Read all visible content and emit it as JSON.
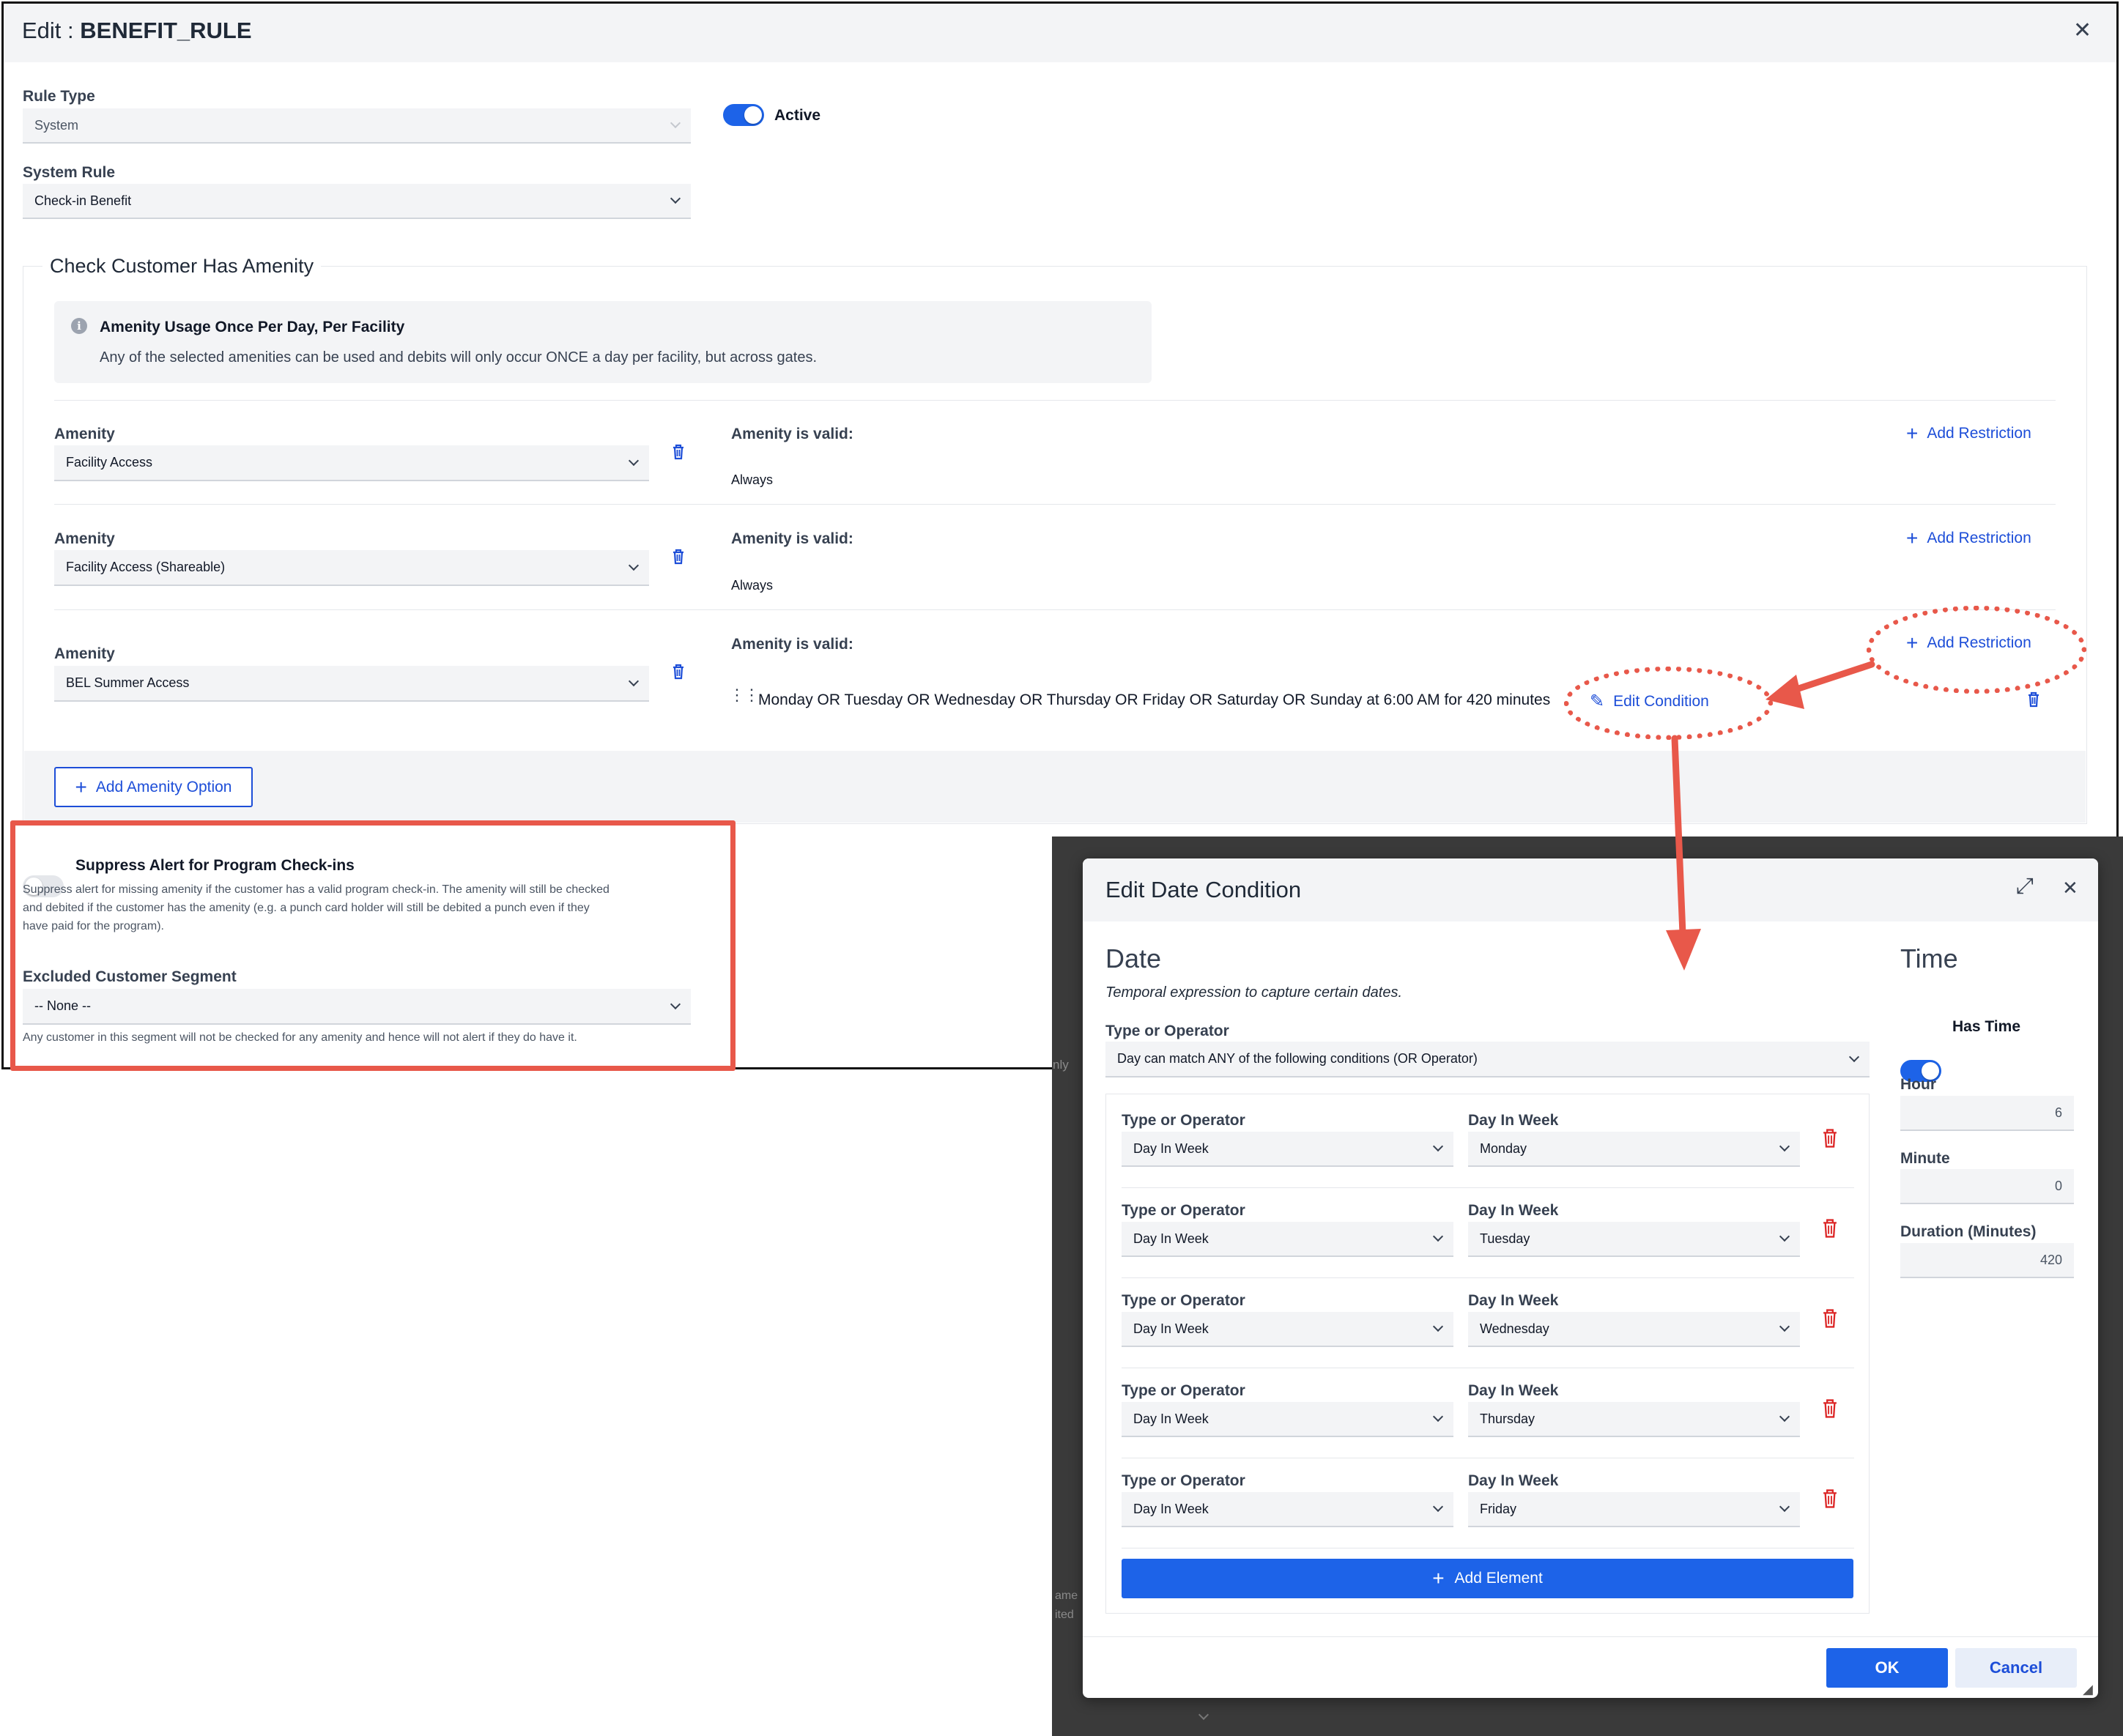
{
  "editor": {
    "title_prefix": "Edit : ",
    "title_name": "BENEFIT_RULE",
    "rule_type_label": "Rule Type",
    "rule_type_value": "System",
    "active_label": "Active",
    "active": true,
    "system_rule_label": "System Rule",
    "system_rule_value": "Check-in Benefit",
    "section_title": "Check Customer Has Amenity",
    "info_title": "Amenity Usage Once Per Day, Per Facility",
    "info_text": "Any of the selected amenities can be used and debits will only occur ONCE a day per facility, but across gates.",
    "amenities": [
      {
        "label": "Amenity",
        "value": "Facility Access",
        "valid_label": "Amenity is valid:",
        "valid_text": "Always",
        "add_restriction": "Add Restriction"
      },
      {
        "label": "Amenity",
        "value": "Facility Access (Shareable)",
        "valid_label": "Amenity is valid:",
        "valid_text": "Always",
        "add_restriction": "Add Restriction"
      },
      {
        "label": "Amenity",
        "value": "BEL Summer Access",
        "valid_label": "Amenity is valid:",
        "valid_text": "Monday OR Tuesday OR Wednesday OR Thursday OR Friday OR Saturday OR Sunday at 6:00 AM for 420 minutes",
        "add_restriction": "Add Restriction",
        "edit_condition": "Edit Condition"
      }
    ],
    "add_amenity_option": "Add Amenity Option",
    "suppress_label": "Suppress Alert for Program Check-ins",
    "suppress_on": false,
    "suppress_help_1": "Suppress alert for missing amenity if the customer has a valid program check-in. The amenity will still be checked",
    "suppress_help_2": "and debited if the customer has the amenity (e.g. a punch card holder will still be debited a punch even if they",
    "suppress_help_3": "have paid for the program).",
    "excluded_label": "Excluded Customer Segment",
    "excluded_value": "-- None --",
    "excluded_help": "Any customer in this segment will not be checked for any amenity and hence will not alert if they do have it."
  },
  "background_fragments": {
    "text_1": "nly",
    "text_2": "ame",
    "text_3": "ited"
  },
  "dialog": {
    "title": "Edit Date Condition",
    "date_heading": "Date",
    "date_subtitle": "Temporal expression to capture certain dates.",
    "type_label": "Type or Operator",
    "type_value": "Day can match ANY of the following conditions (OR Operator)",
    "conditions": [
      {
        "type_label": "Type or Operator",
        "type_value": "Day In Week",
        "day_label": "Day In Week",
        "day_value": "Monday"
      },
      {
        "type_label": "Type or Operator",
        "type_value": "Day In Week",
        "day_label": "Day In Week",
        "day_value": "Tuesday"
      },
      {
        "type_label": "Type or Operator",
        "type_value": "Day In Week",
        "day_label": "Day In Week",
        "day_value": "Wednesday"
      },
      {
        "type_label": "Type or Operator",
        "type_value": "Day In Week",
        "day_label": "Day In Week",
        "day_value": "Thursday"
      },
      {
        "type_label": "Type or Operator",
        "type_value": "Day In Week",
        "day_label": "Day In Week",
        "day_value": "Friday"
      }
    ],
    "add_element": "Add Element",
    "time_heading": "Time",
    "has_time_label": "Has Time",
    "has_time": true,
    "hour_label": "Hour",
    "hour_value": "6",
    "minute_label": "Minute",
    "minute_value": "0",
    "duration_label": "Duration (Minutes)",
    "duration_value": "420",
    "ok": "OK",
    "cancel": "Cancel"
  },
  "colors": {
    "accent": "#1d63e8",
    "annotation": "#e8584a",
    "danger": "#dc2626",
    "link": "#1d4ed8"
  }
}
